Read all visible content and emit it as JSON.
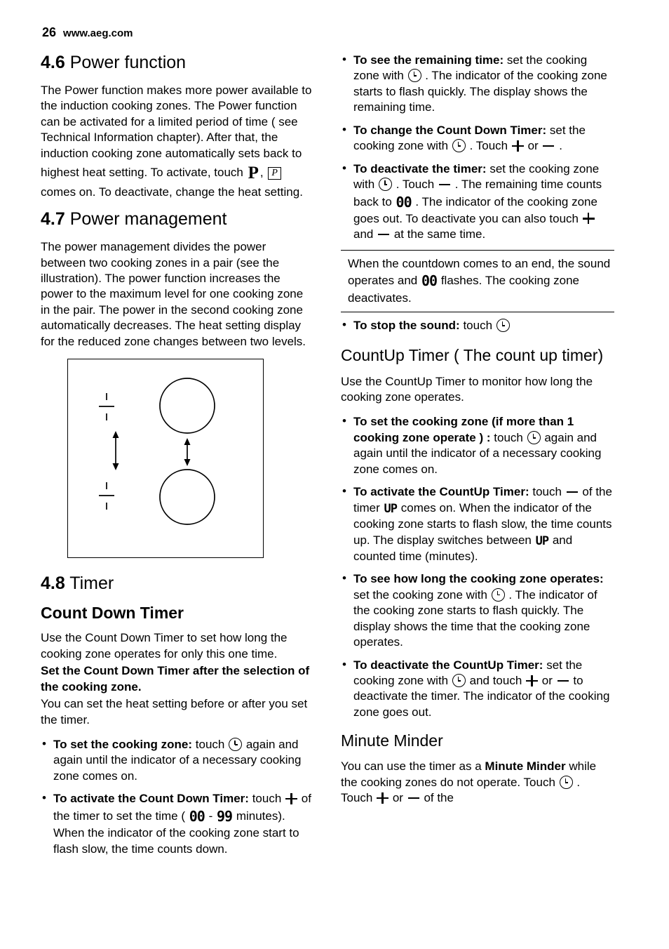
{
  "header": {
    "page_number": "26",
    "site": "www.aeg.com"
  },
  "left": {
    "s46": {
      "num": "4.6",
      "title": "Power function",
      "p1_a": "The Power function makes more power available to the induction cooking zones. The Power function can be activated for a limited period of time ( see Technical Information chapter). After that, the induction cooking zone automatically sets back to highest heat setting. To activate, touch",
      "p1_b": ",",
      "p1_c": "comes on. To deactivate, change the heat setting.",
      "icon_p_big": "P",
      "icon_p_box": "P"
    },
    "s47": {
      "num": "4.7",
      "title": "Power management",
      "p1": "The power management divides the power between two cooking zones in a pair (see the illustration). The power function increases the power to the maximum level for one cooking zone in the pair. The power in the second cooking zone automatically decreases. The heat setting display for the reduced zone changes between two levels."
    },
    "s48": {
      "num": "4.8",
      "title": "Timer",
      "subtitle": "Count Down Timer",
      "p1": "Use the Count Down Timer to set how long the cooking zone operates for only this one time.",
      "p2_bold": "Set the Count Down Timer after the selection of the cooking zone.",
      "p3": "You can set the heat setting before or after you set the timer.",
      "bullets": [
        {
          "lead": "To set the cooking zone:",
          "text_a": "touch",
          "text_b": "again and again until the indicator of a necessary cooking zone comes on."
        },
        {
          "lead": "To activate the Count Down Timer:",
          "text_a": "touch",
          "text_b": "of the timer to set the time (",
          "seg_a": "00",
          "dash": "-",
          "seg_b": "99",
          "text_c": "minutes). When the indicator of the cooking zone start to flash slow, the time counts down."
        }
      ]
    }
  },
  "right": {
    "countdown_bullets": [
      {
        "lead": "To see the remaining time:",
        "text_a": "set the cooking zone with",
        "text_b": ". The indicator of the cooking zone starts to flash quickly. The display shows the remaining time."
      },
      {
        "lead": "To change the Count Down Timer:",
        "text_a": "set the cooking zone with",
        "text_b": ". Touch",
        "text_c": "or",
        "text_d": "."
      },
      {
        "lead": "To deactivate the timer:",
        "text_a": "set the cooking zone with",
        "text_b": ". Touch",
        "text_c": ". The remaining time counts back to",
        "seg": "00",
        "text_d": ". The indicator of the cooking zone goes out. To deactivate you can also touch",
        "text_e": "and",
        "text_f": "at the same time."
      }
    ],
    "note": {
      "text_a": "When the countdown comes to an end, the sound operates and",
      "seg": "00",
      "text_b": "flashes. The cooking zone deactivates."
    },
    "stop_sound": {
      "lead": "To stop the sound:",
      "text": "touch"
    },
    "countup": {
      "title": "CountUp Timer ( The count up timer)",
      "p1": "Use the CountUp Timer to monitor how long the cooking zone operates.",
      "bullets": [
        {
          "lead": "To set the cooking zone (if more than 1 cooking zone operate ) :",
          "text_a": "touch",
          "text_b": "again and again until the indicator of a necessary cooking zone comes on."
        },
        {
          "lead": "To activate the CountUp Timer:",
          "text_a": "touch",
          "text_b": "of the timer",
          "seg_a": "UP",
          "text_c": "comes on. When the indicator of the cooking zone starts to flash slow, the time counts up. The display switches between",
          "seg_b": "UP",
          "text_d": "and counted time (minutes)."
        },
        {
          "lead": "To see how long the cooking zone operates:",
          "text_a": "set the cooking zone with",
          "text_b": ". The indicator of the cooking zone starts to flash quickly. The display shows the time that the cooking zone operates."
        },
        {
          "lead": "To deactivate the CountUp Timer:",
          "text_a": "set the cooking zone with",
          "text_b": "and touch",
          "text_c": "or",
          "text_d": "to deactivate the timer. The indicator of the cooking zone goes out."
        }
      ]
    },
    "minute_minder": {
      "title": "Minute Minder",
      "p_a": "You can use the timer as a",
      "p_bold": "Minute Minder",
      "p_b": "while the cooking zones do not operate. Touch",
      "p_c": ". Touch",
      "p_d": "or",
      "p_e": "of the"
    }
  }
}
